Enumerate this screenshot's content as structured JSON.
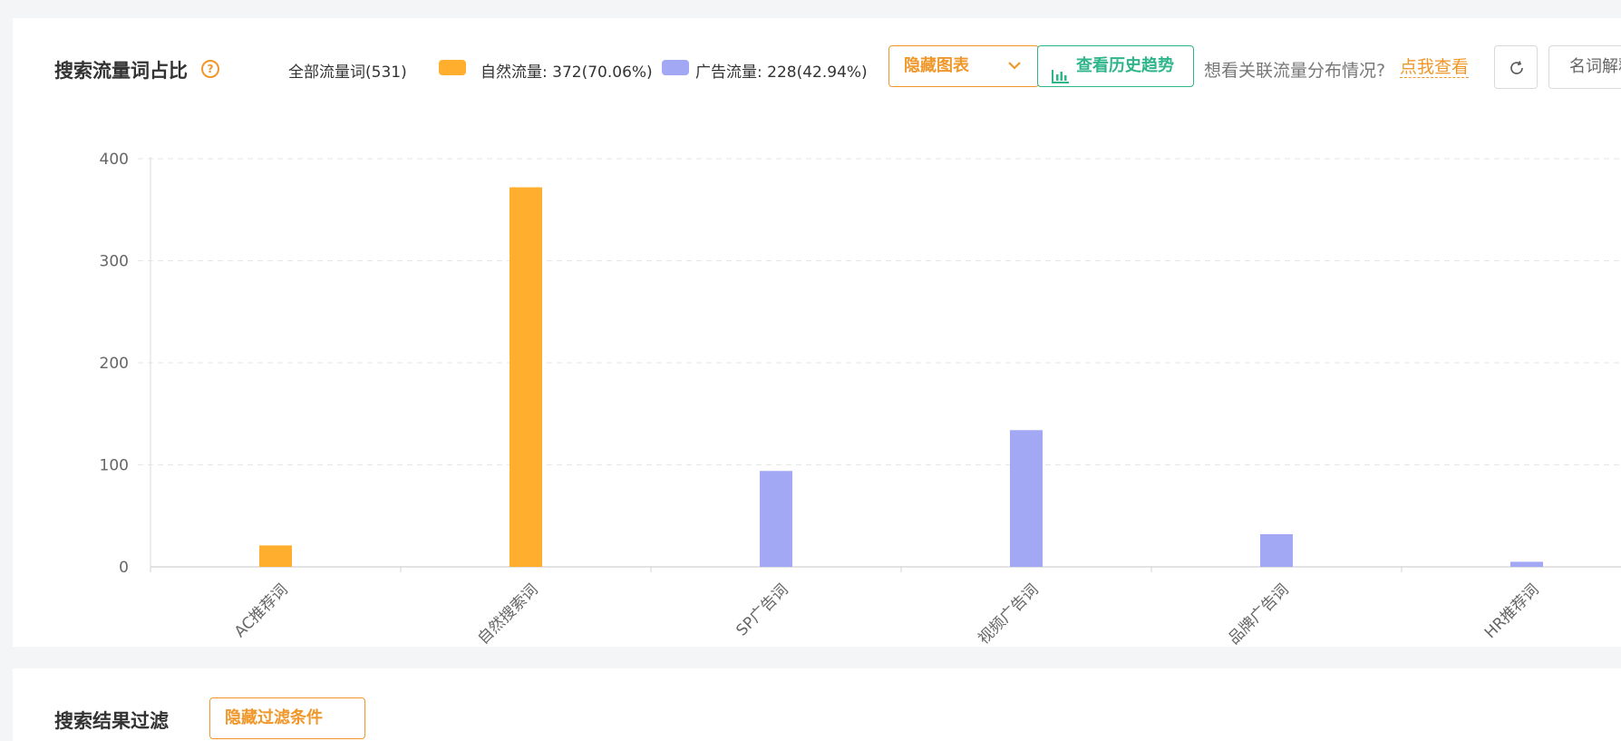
{
  "header": {
    "title": "搜索流量词占比",
    "help_icon": "?",
    "all_words": "全部流量词(531)",
    "natural_label": "自然流量: 372(70.06%)",
    "ad_label": "广告流量: 228(42.94%)",
    "hide_chart_button": "隐藏图表",
    "history_button": "查看历史趋势",
    "ask_text": "想看关联流量分布情况?",
    "ask_link": "点我查看",
    "explain_button": "名词解释"
  },
  "colors": {
    "natural": "#ffae2d",
    "ad": "#a2a8f4",
    "accent_orange": "#f0972a",
    "accent_green": "#2fb58a"
  },
  "icons": {
    "help": "question-circle-icon",
    "chevron": "chevron-down-icon",
    "history": "bar-chart-icon",
    "refresh": "refresh-icon"
  },
  "chart_data": {
    "type": "bar",
    "categories": [
      "AC推荐词",
      "自然搜索词",
      "SP广告词",
      "视频广告词",
      "品牌广告词",
      "HR推荐词"
    ],
    "series": [
      {
        "name": "自然流量",
        "values": [
          21,
          372,
          null,
          null,
          null,
          null
        ]
      },
      {
        "name": "广告流量",
        "values": [
          null,
          null,
          94,
          134,
          32,
          5
        ]
      }
    ],
    "ylim": [
      0,
      400
    ],
    "yticks": [
      0,
      100,
      200,
      300,
      400
    ],
    "grid": true,
    "legend": "top"
  },
  "section2": {
    "title": "搜索结果过滤",
    "button": "隐藏过滤条件"
  }
}
